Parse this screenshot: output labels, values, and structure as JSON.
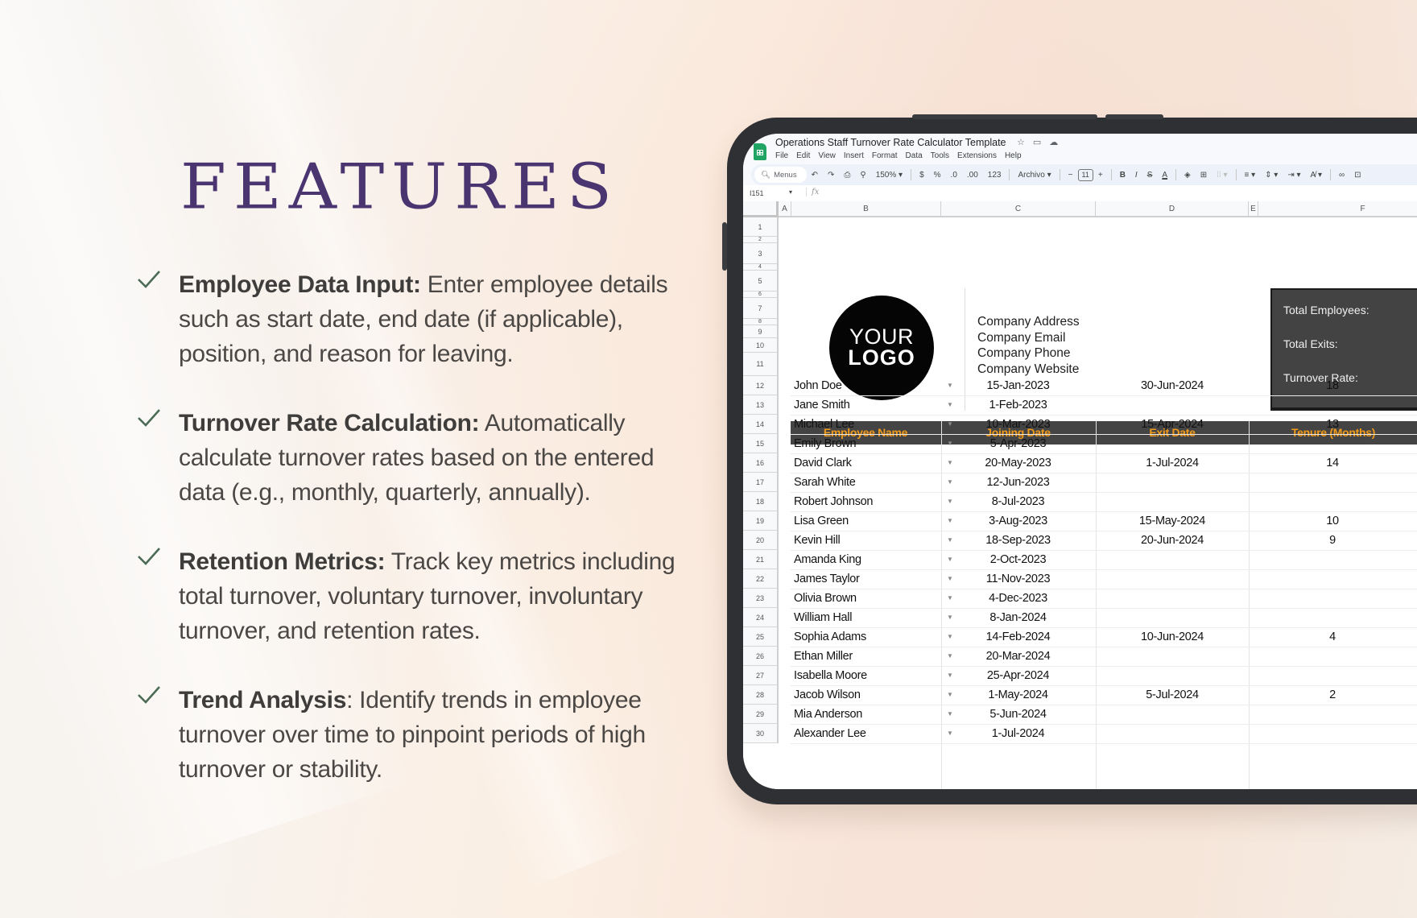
{
  "page": {
    "title": "FEATURES",
    "features": [
      {
        "bold": "Employee Data Input:",
        "text": " Enter employee details such as start date, end date (if applicable), position, and reason for leaving."
      },
      {
        "bold": "Turnover Rate Calculation:",
        "text": " Automatically calculate turnover rates based on the entered data (e.g., monthly, quarterly, annually)."
      },
      {
        "bold": "Retention Metrics:",
        "text": " Track key metrics including total turnover, voluntary turnover, involuntary turnover, and retention rates."
      },
      {
        "bold": "Trend Analysis",
        "text": ": Identify trends in employee turnover over time to pinpoint periods of high turnover or stability."
      }
    ],
    "colors": {
      "title": "#4a3570",
      "check": "#4b6b55",
      "header_bg": "#444444",
      "header_text": "#f19a1a"
    }
  },
  "sheet": {
    "doc_title": "Operations Staff Turnover Rate Calculator Template",
    "title_icons": [
      "star-icon",
      "move-folder-icon",
      "cloud-status-icon"
    ],
    "menu": [
      "File",
      "Edit",
      "View",
      "Insert",
      "Format",
      "Data",
      "Tools",
      "Extensions",
      "Help"
    ],
    "toolbar": {
      "search_label": "Menus",
      "zoom": "150%",
      "currency": "$",
      "percent": "%",
      "dec_decrease": ".0",
      "dec_increase": ".00",
      "number_format": "123",
      "font": "Archivo",
      "font_size": "11"
    },
    "name_box": "I151",
    "fx": "fx",
    "columns": [
      "A",
      "B",
      "C",
      "D",
      "E",
      "F"
    ],
    "row_numbers": [
      "1",
      "2",
      "3",
      "4",
      "5",
      "6",
      "7",
      "8",
      "9",
      "10",
      "11",
      "12",
      "13",
      "14",
      "15",
      "16",
      "17",
      "18",
      "19",
      "20",
      "21",
      "22",
      "23",
      "24",
      "25",
      "26",
      "27",
      "28",
      "29",
      "30"
    ],
    "logo": {
      "line1": "YOUR",
      "line2": "LOGO"
    },
    "company_info": [
      "Company Address",
      "Company Email",
      "Company Phone",
      "Company Website"
    ],
    "summary": [
      "Total Employees:",
      "Total Exits:",
      "Turnover Rate:"
    ],
    "table_headers": [
      "Employee Name",
      "Joining Date",
      "Exit Date",
      "Tenure (Months)"
    ],
    "rows": [
      {
        "name": "John Doe",
        "join": "15-Jan-2023",
        "exit": "30-Jun-2024",
        "tenure": "18"
      },
      {
        "name": "Jane Smith",
        "join": "1-Feb-2023",
        "exit": "",
        "tenure": ""
      },
      {
        "name": "Michael Lee",
        "join": "10-Mar-2023",
        "exit": "15-Apr-2024",
        "tenure": "13"
      },
      {
        "name": "Emily Brown",
        "join": "5-Apr-2023",
        "exit": "",
        "tenure": ""
      },
      {
        "name": "David Clark",
        "join": "20-May-2023",
        "exit": "1-Jul-2024",
        "tenure": "14"
      },
      {
        "name": "Sarah White",
        "join": "12-Jun-2023",
        "exit": "",
        "tenure": ""
      },
      {
        "name": "Robert Johnson",
        "join": "8-Jul-2023",
        "exit": "",
        "tenure": ""
      },
      {
        "name": "Lisa Green",
        "join": "3-Aug-2023",
        "exit": "15-May-2024",
        "tenure": "10"
      },
      {
        "name": "Kevin Hill",
        "join": "18-Sep-2023",
        "exit": "20-Jun-2024",
        "tenure": "9"
      },
      {
        "name": "Amanda King",
        "join": "2-Oct-2023",
        "exit": "",
        "tenure": ""
      },
      {
        "name": "James Taylor",
        "join": "11-Nov-2023",
        "exit": "",
        "tenure": ""
      },
      {
        "name": "Olivia Brown",
        "join": "4-Dec-2023",
        "exit": "",
        "tenure": ""
      },
      {
        "name": "William Hall",
        "join": "8-Jan-2024",
        "exit": "",
        "tenure": ""
      },
      {
        "name": "Sophia Adams",
        "join": "14-Feb-2024",
        "exit": "10-Jun-2024",
        "tenure": "4"
      },
      {
        "name": "Ethan Miller",
        "join": "20-Mar-2024",
        "exit": "",
        "tenure": ""
      },
      {
        "name": "Isabella Moore",
        "join": "25-Apr-2024",
        "exit": "",
        "tenure": ""
      },
      {
        "name": "Jacob Wilson",
        "join": "1-May-2024",
        "exit": "5-Jul-2024",
        "tenure": "2"
      },
      {
        "name": "Mia Anderson",
        "join": "5-Jun-2024",
        "exit": "",
        "tenure": ""
      },
      {
        "name": "Alexander Lee",
        "join": "1-Jul-2024",
        "exit": "",
        "tenure": ""
      }
    ]
  }
}
